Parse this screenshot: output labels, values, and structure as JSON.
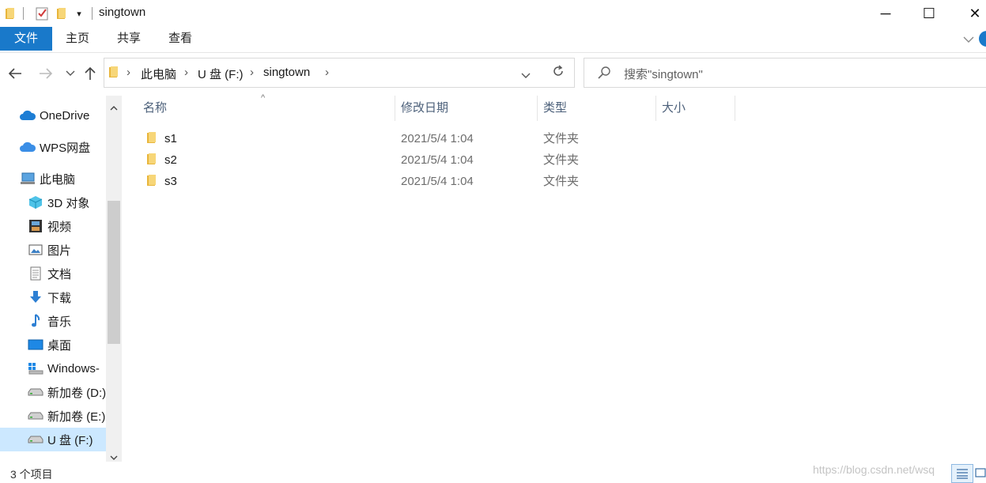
{
  "window": {
    "title": "singtown",
    "minimize": "─",
    "maximize": "☐",
    "close": "✕"
  },
  "ribbon": {
    "tabs": [
      "文件",
      "主页",
      "共享",
      "查看"
    ]
  },
  "address": {
    "path": [
      "此电脑",
      "U 盘 (F:)",
      "singtown"
    ],
    "search_placeholder": "搜索\"singtown\""
  },
  "nav_pane": {
    "items": [
      {
        "label": "OneDrive",
        "icon": "cloud-icon"
      },
      {
        "label": "WPS网盘",
        "icon": "cloud-icon"
      },
      {
        "label": "此电脑",
        "icon": "computer-icon"
      },
      {
        "label": "3D 对象",
        "icon": "cube-icon"
      },
      {
        "label": "视频",
        "icon": "film-icon"
      },
      {
        "label": "图片",
        "icon": "picture-icon"
      },
      {
        "label": "文档",
        "icon": "document-icon"
      },
      {
        "label": "下载",
        "icon": "download-icon"
      },
      {
        "label": "音乐",
        "icon": "music-icon"
      },
      {
        "label": "桌面",
        "icon": "desktop-icon"
      },
      {
        "label": "Windows-",
        "icon": "windows-drive-icon"
      },
      {
        "label": "新加卷 (D:)",
        "icon": "drive-icon"
      },
      {
        "label": "新加卷 (E:)",
        "icon": "drive-icon"
      },
      {
        "label": "U 盘 (F:)",
        "icon": "usb-drive-icon",
        "selected": true
      }
    ]
  },
  "columns": {
    "name": "名称",
    "modified": "修改日期",
    "type": "类型",
    "size": "大小"
  },
  "files": [
    {
      "name": "s1",
      "modified": "2021/5/4 1:04",
      "type": "文件夹",
      "size": ""
    },
    {
      "name": "s2",
      "modified": "2021/5/4 1:04",
      "type": "文件夹",
      "size": ""
    },
    {
      "name": "s3",
      "modified": "2021/5/4 1:04",
      "type": "文件夹",
      "size": ""
    }
  ],
  "status": {
    "item_count": "3 个项目"
  },
  "watermark": "https://blog.csdn.net/wsq",
  "colors": {
    "accent": "#1979ca",
    "folder": "#f0c24e",
    "selected_bg": "#cce8ff"
  }
}
